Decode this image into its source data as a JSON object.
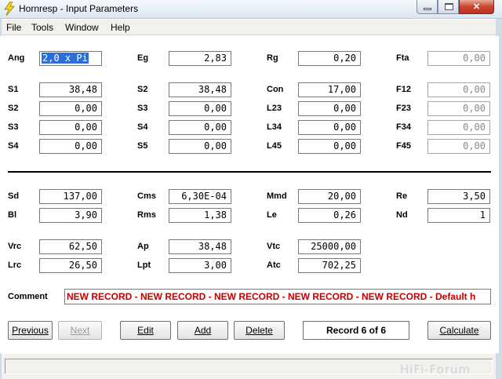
{
  "window": {
    "title": "Hornresp - Input Parameters",
    "app_icon": "lightning-bolt-icon",
    "controls": {
      "minimize": "minimize-icon",
      "maximize": "maximize-icon",
      "close": "close-icon"
    }
  },
  "menu": {
    "items": [
      "File",
      "Tools",
      "Window",
      "Help"
    ]
  },
  "params": {
    "Ang": "2,0 x Pi",
    "Eg": "2,83",
    "Rg": "0,20",
    "Fta": "0,00",
    "S1": "38,48",
    "S2a": "38,48",
    "Con": "17,00",
    "F12": "0,00",
    "S2": "0,00",
    "S3a": "0,00",
    "L23": "0,00",
    "F23": "0,00",
    "S3": "0,00",
    "S4a": "0,00",
    "L34": "0,00",
    "F34": "0,00",
    "S4": "0,00",
    "S5": "0,00",
    "L45": "0,00",
    "F45": "0,00",
    "Sd": "137,00",
    "Cms": "6,30E-04",
    "Mmd": "20,00",
    "Re": "3,50",
    "Bl": "3,90",
    "Rms": "1,38",
    "Le": "0,26",
    "Nd": "1",
    "Vrc": "62,50",
    "Ap": "38,48",
    "Vtc": "25000,00",
    "Lrc": "26,50",
    "Lpt": "3,00",
    "Atc": "702,25"
  },
  "labels": {
    "Ang": "Ang",
    "Eg": "Eg",
    "Rg": "Rg",
    "Fta": "Fta",
    "S1": "S1",
    "S2a": "S2",
    "Con": "Con",
    "F12": "F12",
    "S2": "S2",
    "S3a": "S3",
    "L23": "L23",
    "F23": "F23",
    "S3": "S3",
    "S4a": "S4",
    "L34": "L34",
    "F34": "F34",
    "S4": "S4",
    "S5": "S5",
    "L45": "L45",
    "F45": "F45",
    "Sd": "Sd",
    "Cms": "Cms",
    "Mmd": "Mmd",
    "Re": "Re",
    "Bl": "Bl",
    "Rms": "Rms",
    "Le": "Le",
    "Nd": "Nd",
    "Vrc": "Vrc",
    "Ap": "Ap",
    "Vtc": "Vtc",
    "Lrc": "Lrc",
    "Lpt": "Lpt",
    "Atc": "Atc",
    "Comment": "Comment"
  },
  "comment": "NEW RECORD - NEW RECORD - NEW RECORD - NEW RECORD - NEW RECORD - Default h",
  "buttons": {
    "previous": "Previous",
    "next": "Next",
    "edit": "Edit",
    "add": "Add",
    "delete": "Delete",
    "calculate": "Calculate"
  },
  "record": "Record 6 of 6",
  "watermark": "HiFi-Forum",
  "colors": {
    "comment_text": "#c00000",
    "selection": "#2b6fd6"
  }
}
